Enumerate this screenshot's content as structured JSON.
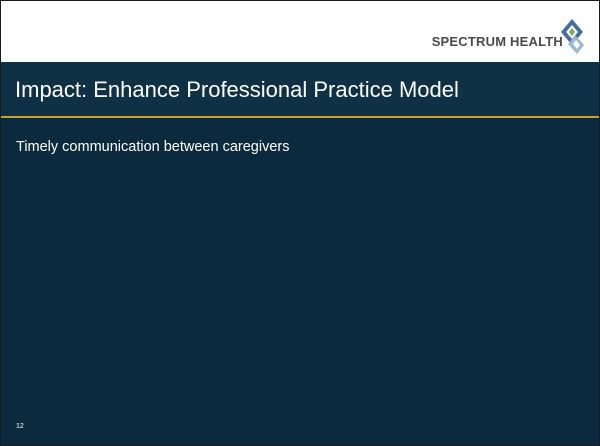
{
  "header": {
    "logo_text": "SPECTRUM HEALTH",
    "logo_icon": "diamond-logo-icon"
  },
  "slide": {
    "title": "Impact: Enhance Professional Practice Model",
    "bullet": "Timely communication between caregivers",
    "page_number": "12"
  },
  "colors": {
    "background": "#0b2a3d",
    "title_band": "#0f3145",
    "divider": "#c9a227",
    "text": "#ffffff",
    "logo_text": "#4a4a4a",
    "logo_blue": "#3f6f9d",
    "logo_green": "#7fae45"
  }
}
